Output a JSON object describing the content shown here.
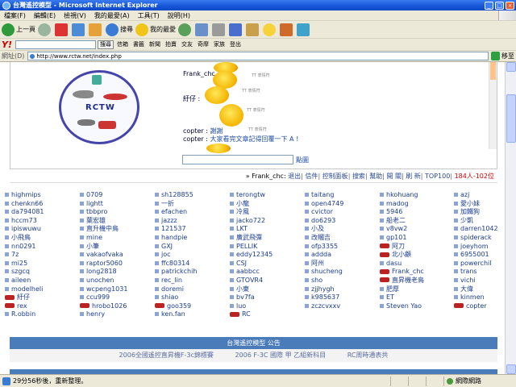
{
  "window": {
    "title": "台灣遙控模型 - Microsoft Internet Explorer",
    "min_glyph": "_",
    "max_glyph": "□",
    "close_glyph": "×"
  },
  "menu": [
    "檔案(F)",
    "編輯(E)",
    "檢視(V)",
    "我的最愛(A)",
    "工具(T)",
    "說明(H)"
  ],
  "toolbar": {
    "back_label": "上一頁",
    "search_label": "搜尋",
    "favorites_label": "我的最愛"
  },
  "yahoo": {
    "logo": "Y!",
    "search_btn": "搜尋",
    "items": [
      "信箱",
      "書籤",
      "新聞",
      "拍賣",
      "交友",
      "奇摩",
      "家族",
      "登出"
    ]
  },
  "address": {
    "label": "網址(D)",
    "url": "http://www.rctw.net/index.php",
    "go_label": "移至"
  },
  "logo_text": "RCTW",
  "shoutbox": {
    "messages": [
      {
        "name": "Frank_chc :",
        "text": ""
      },
      {
        "name": "紆仔 :",
        "text": ""
      },
      {
        "name": "copter :",
        "text": "謝謝"
      },
      {
        "name": "copter :",
        "text": "大家看完文章記得回覆一下 A !"
      }
    ],
    "tt_label": "TT 表情符",
    "send_label": "點圖"
  },
  "nav": {
    "user": "» Frank_chc:",
    "links": [
      "退出",
      "信件",
      "控制面板",
      "搜索",
      "幫助",
      "開 關",
      "刷 新",
      "TOP100"
    ],
    "count": "184人-102位"
  },
  "members": [
    [
      "highmips",
      "chenkn66",
      "da794081",
      "hccm73",
      "ipiswuwu",
      "小飛鳥",
      "nn0291",
      "7z",
      "mi25",
      "szgcq",
      "aileen",
      "modelheli",
      "紆仔",
      "rex",
      "R.obbin"
    ],
    [
      "0709",
      "lightt",
      "tbbpro",
      "葉宏雄",
      "直升機中鳥",
      "mine",
      "小筆",
      "vakaofvaka",
      "raptor5060",
      "long2818",
      "unochen",
      "wcpeng1031",
      "ccu999",
      "hrobo1026",
      "henry"
    ],
    [
      "sh128855",
      "一折",
      "efachen",
      "jazzz",
      "121537",
      "handpie",
      "GXJ",
      "joc",
      "ffc80314",
      "patrickchih",
      "rec_lin",
      "doremi",
      "shiao",
      "goo359",
      "ken.fan"
    ],
    [
      "terongtw",
      "小龍",
      "冷風",
      "jacko722",
      "LKT",
      "廣武飛彈",
      "PELLIK",
      "eddy12345",
      "CSJ",
      "aabbcc",
      "GTOVR4",
      "小東",
      "bv7fa",
      "luo",
      "RC"
    ],
    [
      "taitang",
      "open4749",
      "cvictor",
      "do6293",
      "小及",
      "改幗吉",
      "ofp3355",
      "addda",
      "阿州",
      "shucheng",
      "sho",
      "zjjhygh",
      "k985637",
      "zczcvxxv",
      ""
    ],
    [
      "hkohuang",
      "madog",
      "5946",
      "船老二",
      "v8vw2",
      "gp101",
      "阿刀",
      "北小顧",
      "dasu",
      "Frank_chc",
      "直昇機老鳥",
      "肥厚",
      "ET",
      "Steven Yao",
      ""
    ],
    [
      "azj",
      "愛小妹",
      "加鐵狗",
      "少凱",
      "darren1042",
      "spiderack",
      "joeyhom",
      "6955001",
      "powerchil",
      "trans",
      "vichi",
      "大偉",
      "kinmen",
      "copter",
      ""
    ]
  ],
  "member_bikes": [
    [
      12,
      13
    ],
    [
      13
    ],
    [
      13
    ],
    [
      14
    ],
    [],
    [
      6,
      7,
      9,
      10
    ],
    [
      13
    ]
  ],
  "announcement": {
    "title": "台灣遙控模型 公告",
    "items": [
      "2006全國遙控直昇機F-3c錦標賽",
      "2006 F-3C 國際 甲 乙組新科目",
      "RC周時通表共"
    ]
  },
  "status": {
    "text": "29分56秒後，重新整理。",
    "zone": "網際網路"
  }
}
